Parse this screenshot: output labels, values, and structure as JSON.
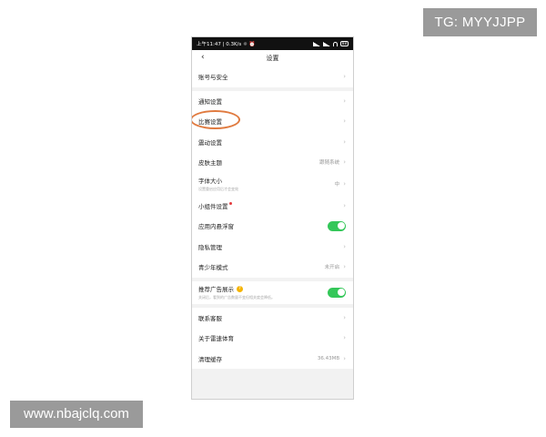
{
  "watermarks": {
    "tg": "TG: MYYJJPP",
    "url": "www.nbajclq.com"
  },
  "status_bar": {
    "left": "上午11:47 | 0.3K/s ☼ ⏰",
    "battery": "88"
  },
  "nav": {
    "back_icon": "‹",
    "title": "设置"
  },
  "icons": {
    "chevron": "›",
    "info": "?"
  },
  "colors": {
    "toggle_on": "#34c759",
    "annotation_circle": "#e07a3f",
    "badge_bg": "#9a9a9a"
  },
  "settings": {
    "account": {
      "label": "账号与安全"
    },
    "notifications": {
      "label": "通知设置"
    },
    "match": {
      "label": "比赛设置"
    },
    "vibration": {
      "label": "震动设置"
    },
    "theme": {
      "label": "皮肤主题",
      "value": "跟随系统"
    },
    "font_size": {
      "label": "字体大小",
      "sub": "设置重启应用后才会变效",
      "value": "中"
    },
    "widgets": {
      "label": "小组件设置"
    },
    "floating_window": {
      "label": "应用内悬浮窗",
      "enabled": true
    },
    "privacy": {
      "label": "隐私管理"
    },
    "teen_mode": {
      "label": "青少年模式",
      "value": "未开启"
    },
    "ads": {
      "label": "推荐广告展示",
      "sub": "关闭后，看到的广告数量不变但相关度会降低。",
      "enabled": true
    },
    "support": {
      "label": "联系客服"
    },
    "about": {
      "label": "关于雷速体育"
    },
    "cache": {
      "label": "清理缓存",
      "value": "36.43MB"
    }
  }
}
